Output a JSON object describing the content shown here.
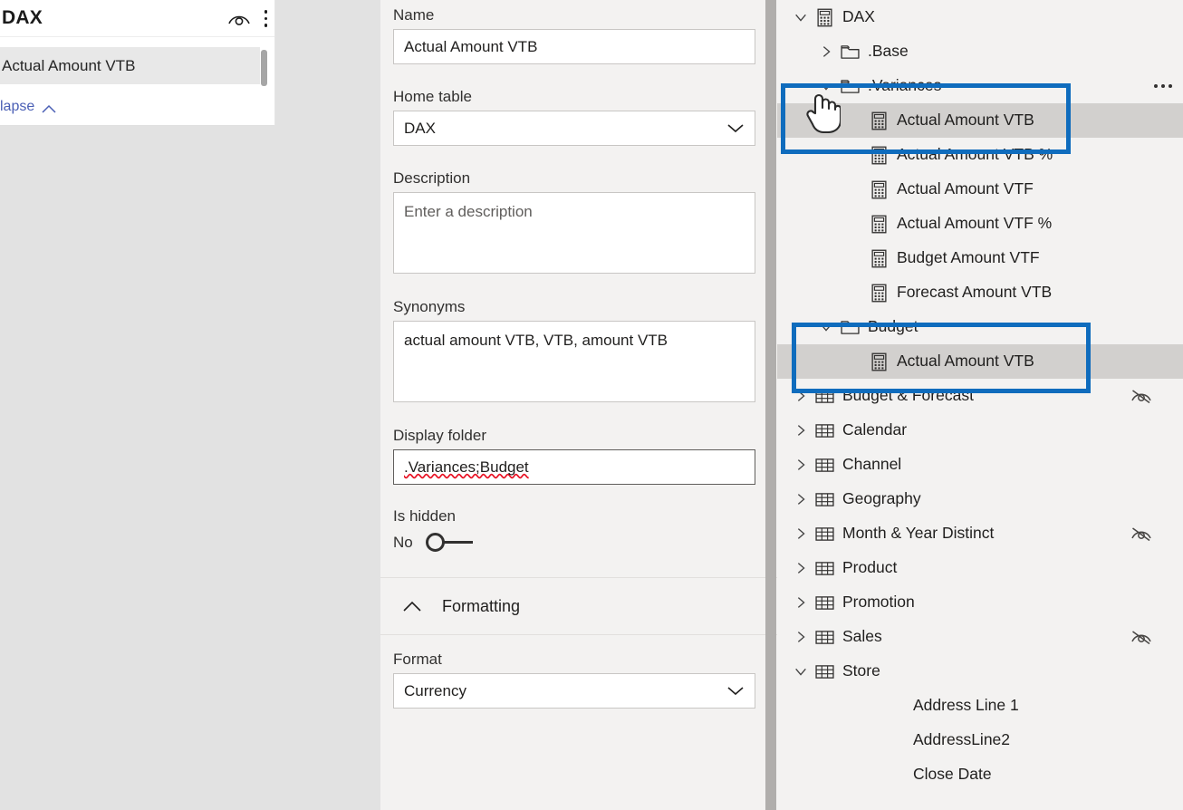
{
  "left_panel": {
    "title": "DAX",
    "icons": {
      "eye": "eye-icon",
      "menu": "kebab-menu-icon"
    },
    "selected_item": "Actual Amount VTB",
    "collapse_label": "lapse"
  },
  "properties": {
    "name": {
      "label": "Name",
      "value": "Actual Amount VTB"
    },
    "home_table": {
      "label": "Home table",
      "value": "DAX"
    },
    "description": {
      "label": "Description",
      "placeholder": "Enter a description",
      "value": ""
    },
    "synonyms": {
      "label": "Synonyms",
      "value": "actual amount VTB, VTB, amount VTB"
    },
    "display_folder": {
      "label": "Display folder",
      "value": ".Variances;Budget"
    },
    "is_hidden": {
      "label": "Is hidden",
      "value": "No"
    },
    "formatting_section": {
      "label": "Formatting"
    },
    "format": {
      "label": "Format",
      "value": "Currency"
    }
  },
  "tree": {
    "nodes": [
      {
        "label": "DAX",
        "indent": 0,
        "twisty": "down",
        "icon": "measure-icon",
        "selected": false,
        "hidden_eye": false,
        "menu": false
      },
      {
        "label": ".Base",
        "indent": 1,
        "twisty": "right",
        "icon": "folder-icon",
        "selected": false,
        "hidden_eye": false,
        "menu": false
      },
      {
        "label": ".Variances",
        "indent": 1,
        "twisty": "down",
        "icon": "folder-icon",
        "selected": false,
        "hidden_eye": false,
        "menu": true
      },
      {
        "label": "Actual Amount VTB",
        "indent": 2,
        "twisty": "none",
        "icon": "measure-icon",
        "selected": true,
        "hidden_eye": false,
        "menu": false
      },
      {
        "label": "Actual Amount VTB %",
        "indent": 2,
        "twisty": "none",
        "icon": "measure-icon",
        "selected": false,
        "hidden_eye": false,
        "menu": false
      },
      {
        "label": "Actual Amount VTF",
        "indent": 2,
        "twisty": "none",
        "icon": "measure-icon",
        "selected": false,
        "hidden_eye": false,
        "menu": false
      },
      {
        "label": "Actual Amount VTF %",
        "indent": 2,
        "twisty": "none",
        "icon": "measure-icon",
        "selected": false,
        "hidden_eye": false,
        "menu": false
      },
      {
        "label": "Budget Amount VTF",
        "indent": 2,
        "twisty": "none",
        "icon": "measure-icon",
        "selected": false,
        "hidden_eye": false,
        "menu": false
      },
      {
        "label": "Forecast Amount VTB",
        "indent": 2,
        "twisty": "none",
        "icon": "measure-icon",
        "selected": false,
        "hidden_eye": false,
        "menu": false
      },
      {
        "label": "Budget",
        "indent": 1,
        "twisty": "down",
        "icon": "folder-icon",
        "selected": false,
        "hidden_eye": false,
        "menu": false
      },
      {
        "label": "Actual Amount VTB",
        "indent": 2,
        "twisty": "none",
        "icon": "measure-icon",
        "selected": true,
        "hidden_eye": false,
        "menu": false
      },
      {
        "label": "Budget & Forecast",
        "indent": 0,
        "twisty": "right",
        "icon": "table-icon",
        "selected": false,
        "hidden_eye": true,
        "menu": false
      },
      {
        "label": "Calendar",
        "indent": 0,
        "twisty": "right",
        "icon": "table-icon",
        "selected": false,
        "hidden_eye": false,
        "menu": false
      },
      {
        "label": "Channel",
        "indent": 0,
        "twisty": "right",
        "icon": "table-icon",
        "selected": false,
        "hidden_eye": false,
        "menu": false
      },
      {
        "label": "Geography",
        "indent": 0,
        "twisty": "right",
        "icon": "table-icon",
        "selected": false,
        "hidden_eye": false,
        "menu": false
      },
      {
        "label": "Month & Year Distinct",
        "indent": 0,
        "twisty": "right",
        "icon": "table-icon",
        "selected": false,
        "hidden_eye": true,
        "menu": false
      },
      {
        "label": "Product",
        "indent": 0,
        "twisty": "right",
        "icon": "table-icon",
        "selected": false,
        "hidden_eye": false,
        "menu": false
      },
      {
        "label": "Promotion",
        "indent": 0,
        "twisty": "right",
        "icon": "table-icon",
        "selected": false,
        "hidden_eye": false,
        "menu": false
      },
      {
        "label": "Sales",
        "indent": 0,
        "twisty": "right",
        "icon": "table-icon",
        "selected": false,
        "hidden_eye": true,
        "menu": false
      },
      {
        "label": "Store",
        "indent": 0,
        "twisty": "down",
        "icon": "table-icon",
        "selected": false,
        "hidden_eye": false,
        "menu": false
      },
      {
        "label": "Address Line 1",
        "indent": 3,
        "twisty": "none",
        "icon": "none",
        "selected": false,
        "hidden_eye": false,
        "menu": false
      },
      {
        "label": "AddressLine2",
        "indent": 3,
        "twisty": "none",
        "icon": "none",
        "selected": false,
        "hidden_eye": false,
        "menu": false
      },
      {
        "label": "Close Date",
        "indent": 3,
        "twisty": "none",
        "icon": "none",
        "selected": false,
        "hidden_eye": false,
        "menu": false
      }
    ]
  },
  "annotations": {
    "highlight_color": "#0f6cbd",
    "boxes": [
      "variances-folder-highlight",
      "budget-folder-highlight"
    ]
  }
}
